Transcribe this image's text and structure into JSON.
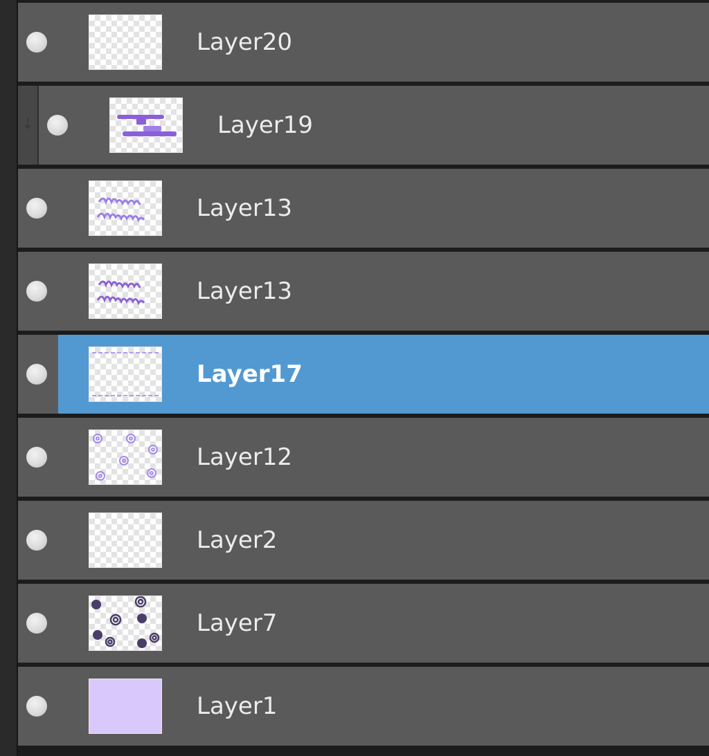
{
  "layers_panel": {
    "layers": [
      {
        "name": "Layer20",
        "thumbnail": "transparent",
        "clipped": false,
        "selected": false,
        "visible": true
      },
      {
        "name": "Layer19",
        "thumbnail": "purple-shelves",
        "clipped": true,
        "selected": false,
        "visible": true
      },
      {
        "name": "Layer13",
        "thumbnail": "purple-lettering",
        "clipped": false,
        "selected": false,
        "visible": true
      },
      {
        "name": "Layer13",
        "thumbnail": "purple-lettering",
        "clipped": false,
        "selected": false,
        "visible": true
      },
      {
        "name": "Layer17",
        "thumbnail": "purple-borders",
        "clipped": false,
        "selected": true,
        "visible": true
      },
      {
        "name": "Layer12",
        "thumbnail": "purple-swirls",
        "clipped": false,
        "selected": false,
        "visible": true
      },
      {
        "name": "Layer2",
        "thumbnail": "transparent",
        "clipped": false,
        "selected": false,
        "visible": true
      },
      {
        "name": "Layer7",
        "thumbnail": "dark-dots-swirls",
        "clipped": false,
        "selected": false,
        "visible": true
      },
      {
        "name": "Layer1",
        "thumbnail": "solid-lavender",
        "clipped": false,
        "selected": false,
        "visible": true
      }
    ],
    "colors": {
      "row_background": "#5a5a5a",
      "selected_background": "#5299d2",
      "lavender_fill": "#d9c8fc",
      "purple_art": "#8a5fd9"
    },
    "icons": {
      "visibility": "eye-dot-icon",
      "clipping": "clip-arrow-icon"
    }
  }
}
